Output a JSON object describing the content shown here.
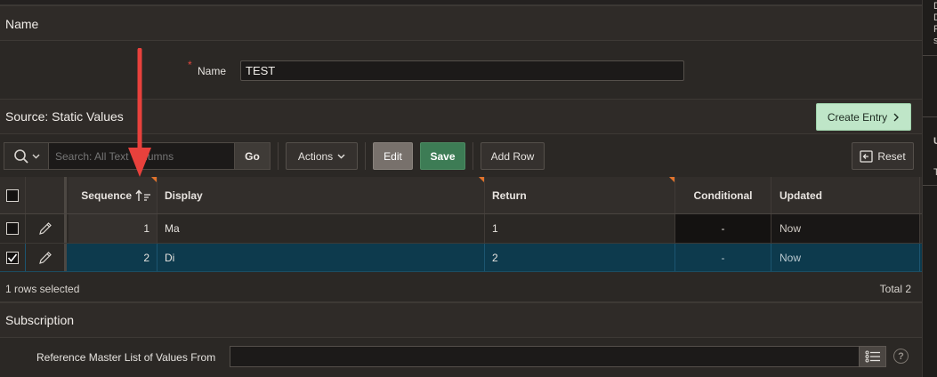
{
  "name_region": {
    "title": "Name",
    "field_label": "Name",
    "required_marker": "*",
    "field_value": "TEST"
  },
  "source_region": {
    "title": "Source: Static Values",
    "create_entry_label": "Create Entry"
  },
  "toolbar": {
    "search_placeholder": "Search: All Text Columns",
    "go_label": "Go",
    "actions_label": "Actions",
    "edit_label": "Edit",
    "save_label": "Save",
    "add_row_label": "Add Row",
    "reset_label": "Reset"
  },
  "grid": {
    "columns": [
      "Sequence",
      "Display",
      "Return",
      "Conditional",
      "Updated"
    ],
    "rows": [
      {
        "sequence": "1",
        "display": "Ma",
        "return": "1",
        "conditional": "-",
        "updated": "Now",
        "selected": false
      },
      {
        "sequence": "2",
        "display": "Di",
        "return": "2",
        "conditional": "-",
        "updated": "Now",
        "selected": true
      }
    ],
    "selection_text": "1 rows selected",
    "total_text": "Total 2"
  },
  "subscription_region": {
    "title": "Subscription",
    "field_label": "Reference Master List of Values From",
    "field_value": ""
  },
  "right_panel": {
    "letters_top": [
      "D",
      "D",
      "F",
      "s"
    ],
    "letter_mid": "U",
    "letter_low": "T"
  },
  "colors": {
    "accent_green": "#3d7c55",
    "create_entry_bg": "#bfe6c8",
    "selected_row": "#0d3a4d",
    "annotation_arrow": "#e8413c",
    "required_star": "#e0473e"
  }
}
